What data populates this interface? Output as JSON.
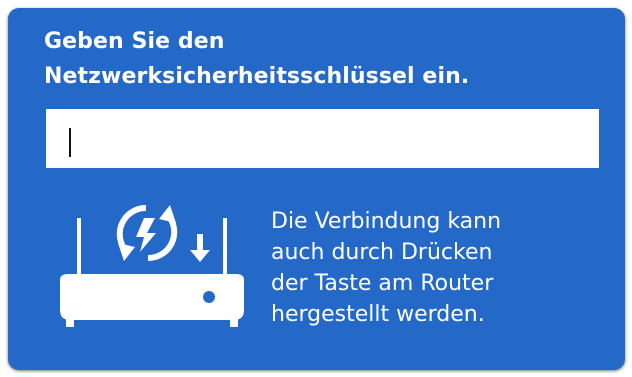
{
  "dialog": {
    "prompt_lines": [
      "Geben Sie den",
      "Netzwerksicherheitsschlüssel ein."
    ],
    "key_field": {
      "value": ""
    },
    "hint_lines": [
      "Die Verbindung kann",
      "auch durch Drücken",
      "der Taste am Router",
      "hergestellt werden."
    ],
    "icons": {
      "router": "wps-router-icon",
      "wps": "wps-sync-icon",
      "arrow": "arrow-down-icon"
    },
    "colors": {
      "panel_background": "#2469c8",
      "text": "#ffffff",
      "input_background": "#ffffff"
    }
  }
}
